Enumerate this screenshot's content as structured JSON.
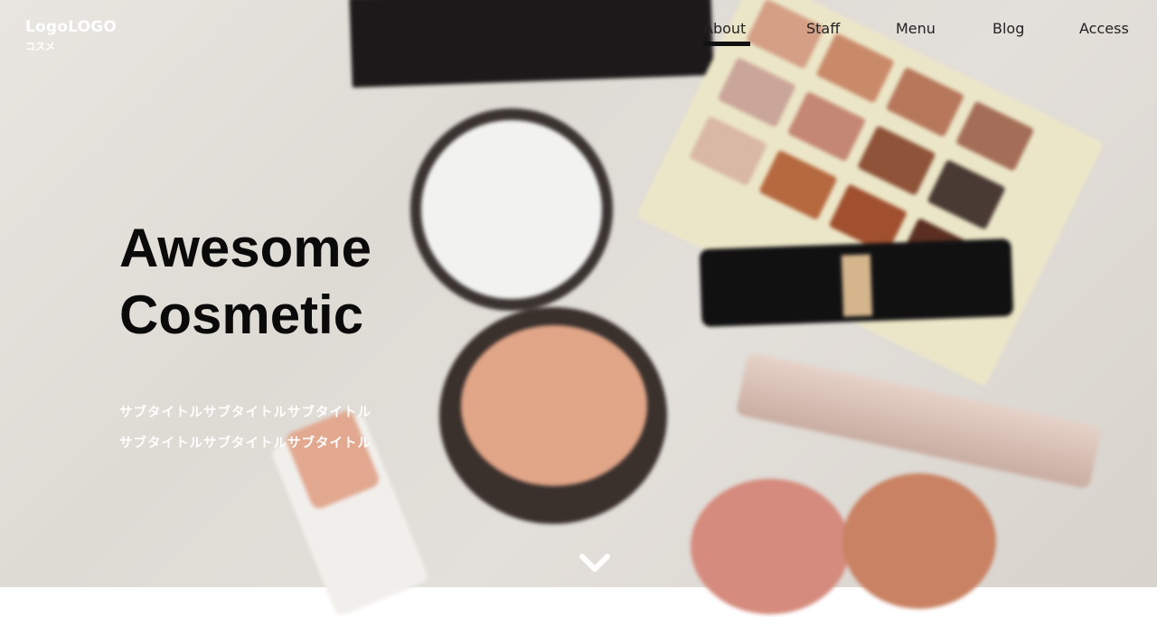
{
  "logo": {
    "main": "LogoLOGO",
    "sub": "コスメ"
  },
  "nav": {
    "items": [
      {
        "label": "About"
      },
      {
        "label": "Staff"
      },
      {
        "label": "Menu"
      },
      {
        "label": "Blog"
      },
      {
        "label": "Access"
      }
    ],
    "active": "About"
  },
  "hero": {
    "title_line1": "Awesome",
    "title_line2": "Cosmetic",
    "subtitle_line1": "サブタイトルサブタイトルサブタイトル",
    "subtitle_line2": "サブタイトルサブタイトルサブタイトル"
  },
  "icons": {
    "scroll": "chevron-down-icon"
  },
  "colors": {
    "title": "#0a0a0a",
    "nav_text": "#222222",
    "subtitle": "#ffffff",
    "active_underline": "#111111"
  }
}
